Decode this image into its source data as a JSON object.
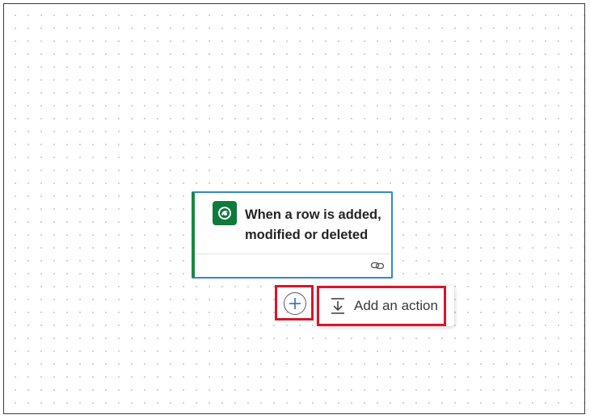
{
  "trigger": {
    "title": "When a row is added, modified or deleted",
    "icon": "dataverse-icon",
    "footer_icon": "link-icon",
    "accent_color": "#1a8744",
    "border_color": "#2f88d8"
  },
  "insert": {
    "plus_icon": "plus-icon",
    "menu": {
      "item_label": "Add an action",
      "item_icon": "add-action-icon"
    },
    "highlight_color": "#d9162b"
  }
}
